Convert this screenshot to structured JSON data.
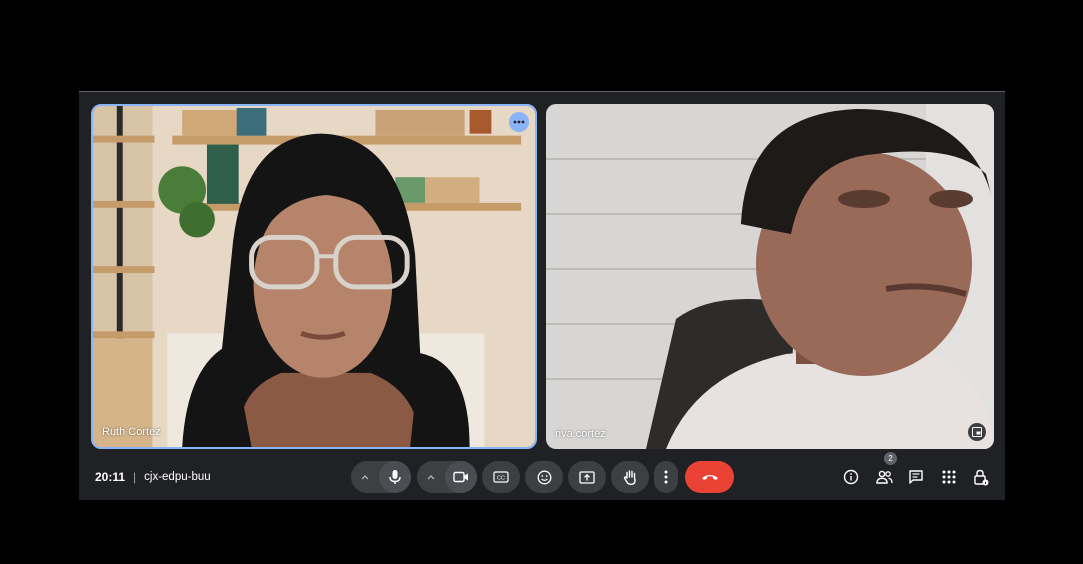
{
  "participants": [
    {
      "name": "Ruth Cortez",
      "speaking": true
    },
    {
      "name": "riva cortez",
      "speaking": false
    }
  ],
  "meeting": {
    "time": "20:11",
    "separator": "|",
    "code": "cjx-edpu-buu"
  },
  "controls": {
    "mic": {
      "icon": "microphone-icon"
    },
    "camera": {
      "icon": "video-camera-icon"
    },
    "captions": {
      "icon": "closed-captions-icon"
    },
    "reactions": {
      "icon": "emoji-icon"
    },
    "present": {
      "icon": "present-screen-icon"
    },
    "raise_hand": {
      "icon": "hand-icon"
    },
    "more": {
      "icon": "more-vert-icon"
    },
    "leave": {
      "icon": "end-call-icon",
      "color": "#ea4335"
    }
  },
  "right_panel": {
    "info": {
      "icon": "info-icon"
    },
    "people": {
      "icon": "people-icon",
      "count": "2"
    },
    "chat": {
      "icon": "chat-icon"
    },
    "activities": {
      "icon": "apps-grid-icon"
    },
    "host_controls": {
      "icon": "lock-icon"
    }
  },
  "colors": {
    "accent": "#8ab4f8",
    "background": "#202124",
    "button": "#3c4043",
    "end_call": "#ea4335"
  }
}
